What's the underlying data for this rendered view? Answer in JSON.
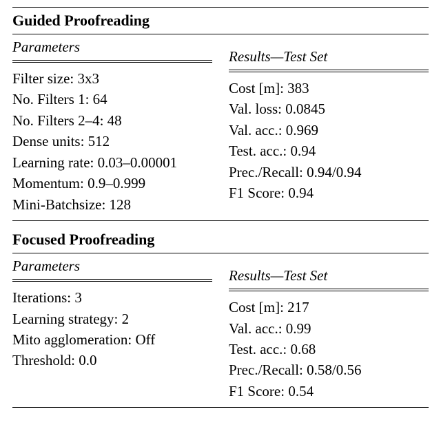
{
  "sections": [
    {
      "title": "Guided Proofreading",
      "left": {
        "header": "Parameters",
        "lines": [
          "Filter size: 3x3",
          "No. Filters 1: 64",
          "No. Filters 2–4: 48",
          "Dense units: 512",
          "Learning rate: 0.03–0.00001",
          "Momentum: 0.9–0.999",
          "Mini-Batchsize: 128"
        ]
      },
      "right": {
        "header": "Results—Test Set",
        "lines": [
          "Cost [m]: 383",
          "Val. loss: 0.0845",
          "Val. acc.: 0.969",
          "Test. acc.: 0.94",
          "Prec./Recall: 0.94/0.94",
          "F1 Score: 0.94"
        ]
      }
    },
    {
      "title": "Focused Proofreading",
      "left": {
        "header": "Parameters",
        "lines": [
          "Iterations: 3",
          "Learning strategy: 2",
          "Mito agglomeration: Off",
          "Threshold: 0.0"
        ]
      },
      "right": {
        "header": "Results—Test Set",
        "lines": [
          "Cost [m]: 217",
          "Val. acc.: 0.99",
          "Test. acc.: 0.68",
          "Prec./Recall: 0.58/0.56",
          "F1 Score: 0.54"
        ]
      }
    }
  ]
}
